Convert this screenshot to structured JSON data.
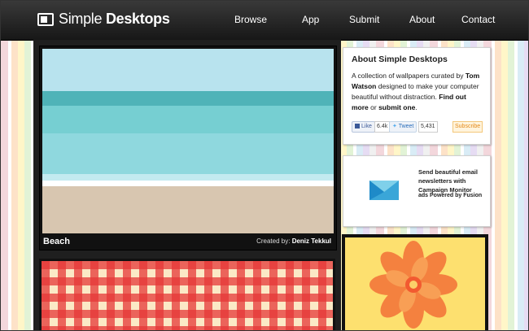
{
  "header": {
    "logo_regular": "Simple",
    "logo_bold": "Desktops",
    "nav": [
      {
        "label": "Browse"
      },
      {
        "label": "App"
      },
      {
        "label": "Submit"
      },
      {
        "label": "About"
      },
      {
        "label": "Contact"
      }
    ]
  },
  "featured": {
    "title": "Beach",
    "credit_prefix": "Created by:",
    "credit_author": "Deniz Tekkul"
  },
  "about": {
    "heading": "About Simple Desktops",
    "text_1": "A collection of wallpapers curated by ",
    "author": "Tom Watson",
    "text_2": " designed to make your computer beautiful without distraction. ",
    "find_out_more": "Find out more",
    "text_3": " or ",
    "submit_one": "submit one",
    "text_4": ".",
    "like_label": "Like",
    "like_count": "6.4k",
    "tweet_label": "Tweet",
    "tweet_count": "5,431",
    "subscribe_label": "Subscribe"
  },
  "ad": {
    "text": "Send beautiful email newsletters with Campaign Monitor",
    "note": "ads Powered by Fusion"
  },
  "colors": {
    "header_bg": "#1f1f1f",
    "beach_sky": "#b7e2ec",
    "beach_water": "#5fbfc5",
    "beach_sand": "#d8c7b1",
    "thumb_bg": "#fde06f",
    "flower": "#f26b3a",
    "checker_red": "#e63737"
  },
  "icons": {
    "logo": "desktop-monitor-icon",
    "ad_logo": "campaign-monitor-envelope-icon",
    "thumb_flower": "flower-icon"
  }
}
